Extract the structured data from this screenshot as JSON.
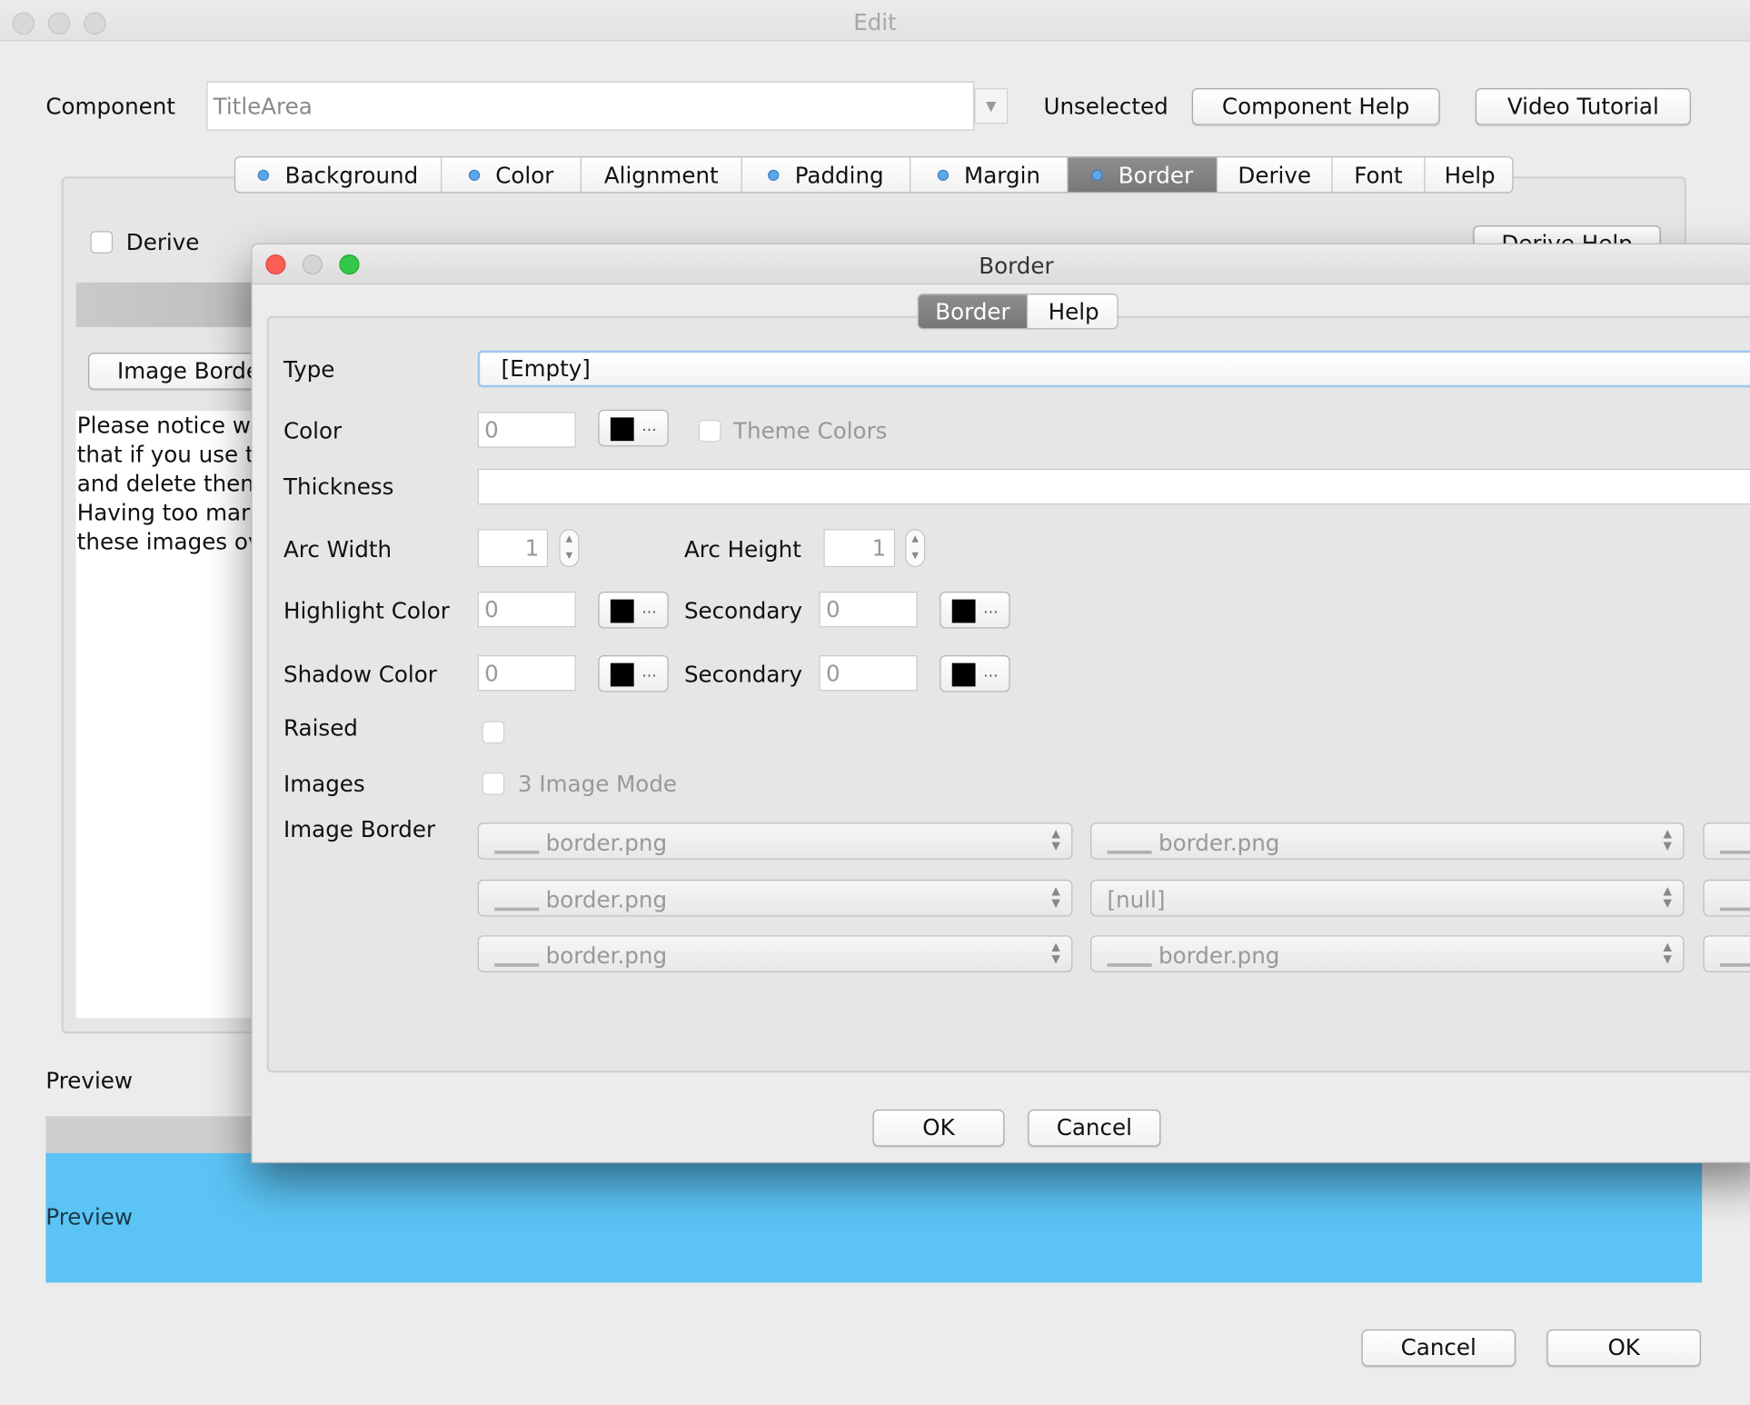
{
  "window": {
    "title": "Edit"
  },
  "component": {
    "label": "Component",
    "value": "TitleArea",
    "status": "Unselected",
    "help_button": "Component Help",
    "video_button": "Video Tutorial"
  },
  "tabs": [
    {
      "label": "Background",
      "dot": true
    },
    {
      "label": "Color",
      "dot": true
    },
    {
      "label": "Alignment",
      "dot": false
    },
    {
      "label": "Padding",
      "dot": true
    },
    {
      "label": "Margin",
      "dot": true
    },
    {
      "label": "Border",
      "dot": true,
      "selected": true
    },
    {
      "label": "Derive",
      "dot": false
    },
    {
      "label": "Font",
      "dot": false
    },
    {
      "label": "Help",
      "dot": false
    }
  ],
  "border_tab": {
    "derive_label": "Derive",
    "derive_help": "Derive Help",
    "image_border_button": "Image Borde",
    "notice_lines": [
      "Please notice w",
      "that if you use t",
      "and delete them",
      "Having too mar",
      "these images ov"
    ]
  },
  "preview": {
    "label": "Preview",
    "text": "Preview",
    "color": "#5bc4f5"
  },
  "footer": {
    "cancel": "Cancel",
    "ok": "OK"
  },
  "dialog": {
    "title": "Border",
    "tabs": [
      {
        "label": "Border",
        "selected": true
      },
      {
        "label": "Help"
      }
    ],
    "type": {
      "label": "Type",
      "value": "[Empty]"
    },
    "color": {
      "label": "Color",
      "value": "0",
      "swatch": "#000000",
      "theme_colors": "Theme Colors"
    },
    "thickness": {
      "label": "Thickness",
      "value": ""
    },
    "arc_width": {
      "label": "Arc Width",
      "value": "1"
    },
    "arc_height": {
      "label": "Arc Height",
      "value": "1"
    },
    "highlight": {
      "label": "Highlight Color",
      "value": "0",
      "secondary_label": "Secondary",
      "secondary_value": "0"
    },
    "shadow": {
      "label": "Shadow Color",
      "value": "0",
      "secondary_label": "Secondary",
      "secondary_value": "0"
    },
    "raised": {
      "label": "Raised",
      "checked": false
    },
    "images": {
      "label": "Images",
      "three_image_mode": "3 Image Mode"
    },
    "image_border": {
      "label": "Image Border",
      "rows": [
        [
          "border.png",
          "border.png"
        ],
        [
          "border.png",
          "[null]"
        ],
        [
          "border.png",
          "border.png"
        ]
      ]
    },
    "ellipsis": "...",
    "ok": "OK",
    "cancel": "Cancel"
  }
}
